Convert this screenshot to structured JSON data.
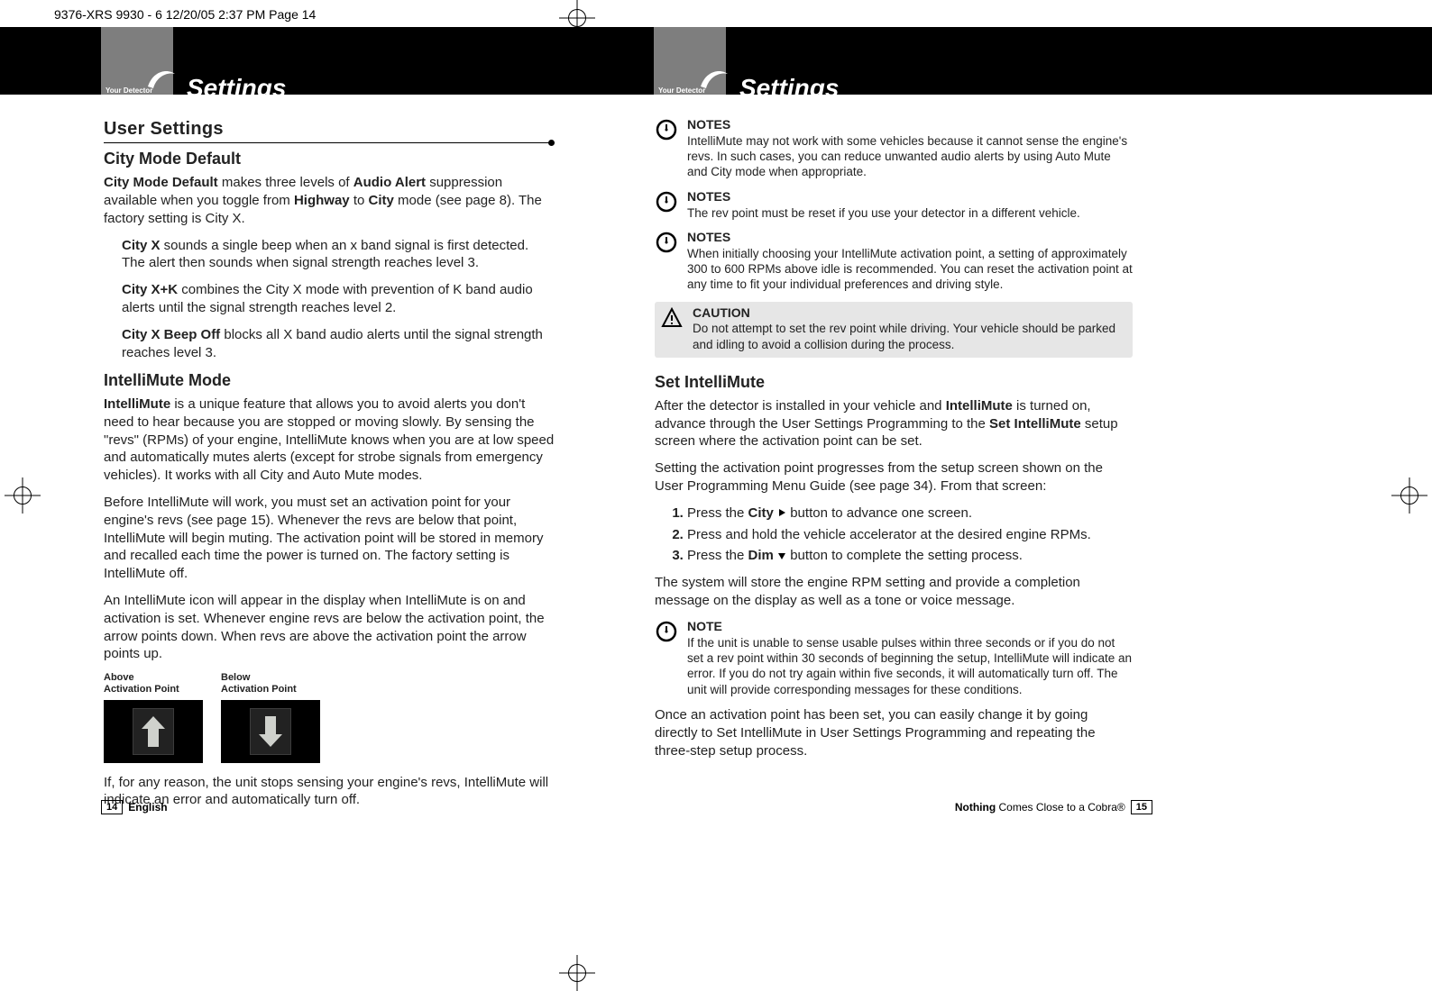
{
  "print_line": "9376-XRS 9930 - 6  12/20/05  2:37 PM  Page 14",
  "header": {
    "your_detector": "Your Detector",
    "settings": "Settings"
  },
  "left": {
    "user_settings": "User Settings",
    "city_mode_default_h": "City Mode Default",
    "city_mode_default_p": "City Mode Default makes three levels of Audio Alert suppression available when you toggle from Highway to City mode (see page 8). The factory setting is City X.",
    "city_x": "City X sounds a single beep when an x band signal is first detected. The alert then sounds when signal strength reaches level 3.",
    "city_xk": "City X+K combines the City X mode with prevention of K band audio alerts until the signal strength reaches level 2.",
    "city_x_beep": "City X Beep Off blocks all X band audio alerts until the signal strength reaches level 3.",
    "intellimute_h": "IntelliMute Mode",
    "intellimute_p1": "IntelliMute is a unique feature that allows you to avoid alerts you don't need to hear because you are stopped or moving slowly. By sensing the \"revs\" (RPMs) of your engine, IntelliMute knows when you are at low speed and automatically mutes alerts (except for strobe signals from emergency vehicles). It works with all City and Auto Mute modes.",
    "intellimute_p2": "Before IntelliMute will work, you must set an activation point for your engine's revs (see page 15). Whenever the revs are below that point, IntelliMute will begin muting. The activation point will be stored in memory and recalled each time the power is turned on. The factory setting is IntelliMute off.",
    "intellimute_p3": "An IntelliMute icon will appear in the display when IntelliMute is on and activation is set. Whenever engine revs are below the activation point, the arrow points down. When revs are above the activation point the arrow points up.",
    "cap_above": "Above\nActivation Point",
    "cap_below": "Below\nActivation Point",
    "intellimute_p4": "If, for any reason, the unit stops sensing your engine's revs, IntelliMute will indicate an error and automatically turn off."
  },
  "right": {
    "note1_t": "NOTES",
    "note1_b": "IntelliMute may not work with some vehicles because it cannot sense the engine's revs. In such cases, you can reduce unwanted audio alerts by using Auto Mute and City mode when appropriate.",
    "note2_t": "NOTES",
    "note2_b": "The rev point must be reset if you use your detector in a different vehicle.",
    "note3_t": "NOTES",
    "note3_b": "When initially choosing your IntelliMute activation point, a setting of approximately 300 to 600 RPMs above idle is recommended. You can reset the activation point at any time to fit your individual preferences and driving style.",
    "caution_t": "CAUTION",
    "caution_b": "Do not attempt to set the rev point while driving. Your vehicle should be parked and idling to avoid a collision during the process.",
    "set_h": "Set IntelliMute",
    "set_p1": "After the detector is installed in your vehicle and IntelliMute is turned on, advance through the User Settings Programming to the Set IntelliMute setup screen where the activation point can be set.",
    "set_p2": "Setting the activation point progresses from the setup screen shown on the User Programming Menu Guide (see page 34). From that screen:",
    "step1_a": "Press the ",
    "step1_b": "City",
    "step1_c": " button to advance one screen.",
    "step2": "Press and hold the vehicle accelerator at the desired engine RPMs.",
    "step3_a": "Press the ",
    "step3_b": "Dim",
    "step3_c": " button to complete the setting process.",
    "set_p3": "The system will store the engine RPM setting and provide a completion message on the display as well as a tone or voice message.",
    "note4_t": "NOTE",
    "note4_b": "If the unit is unable to sense usable pulses within three seconds or if you do not set a rev point within 30 seconds of beginning the setup, IntelliMute will indicate an error. If you do not try again within five seconds, it will automatically turn off. The unit will provide corresponding messages for these conditions.",
    "closing": "Once an activation point has been set, you can easily change it by going directly to Set IntelliMute in User Settings Programming and repeating the three-step setup process."
  },
  "footer": {
    "left_page": "14",
    "left_lang": "English",
    "right_text_b": "Nothing",
    "right_text": " Comes Close to a Cobra®",
    "right_page": "15"
  }
}
